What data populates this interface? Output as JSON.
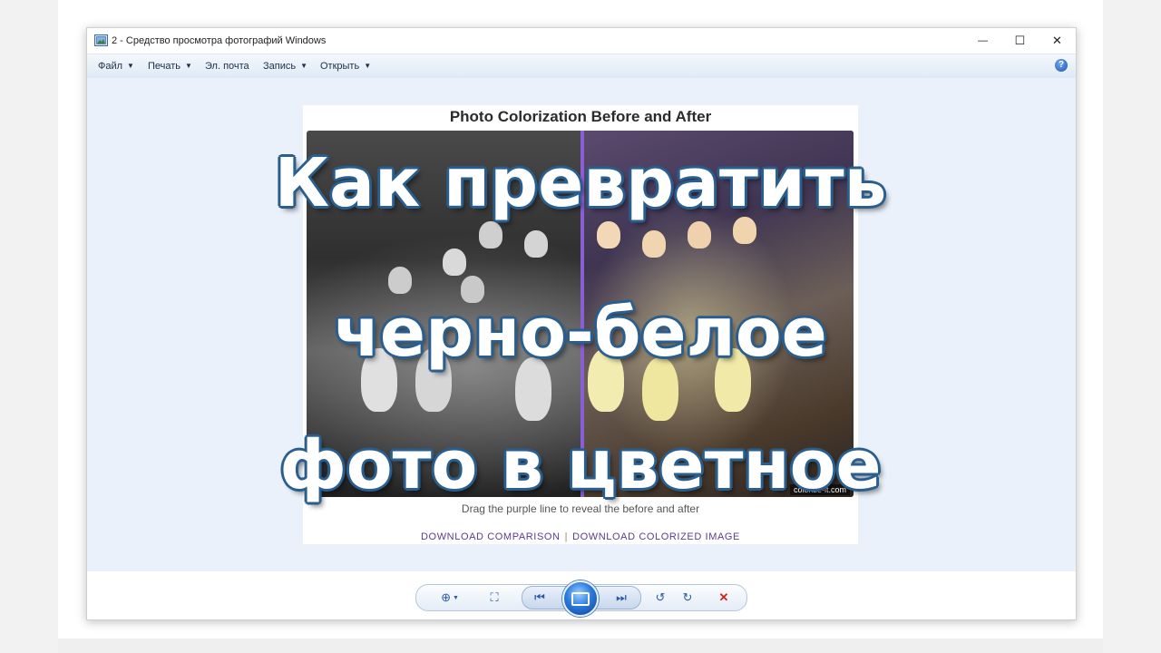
{
  "window": {
    "title": "2 - Средство просмотра фотографий Windows",
    "minimize_glyph": "—",
    "maximize_glyph": "☐",
    "close_glyph": "✕"
  },
  "menu": {
    "items": [
      {
        "label": "Файл",
        "has_dropdown": true
      },
      {
        "label": "Печать",
        "has_dropdown": true
      },
      {
        "label": "Эл. почта",
        "has_dropdown": false
      },
      {
        "label": "Запись",
        "has_dropdown": true
      },
      {
        "label": "Открыть",
        "has_dropdown": true
      }
    ],
    "caret_glyph": "▼",
    "help_glyph": "?"
  },
  "image": {
    "title": "Photo Colorization Before and After",
    "caption": "Drag the purple line to reveal the before and after",
    "watermark": "colorize-it.com",
    "link_comparison": "DOWNLOAD COMPARISON",
    "link_separator": "|",
    "link_colorized": "DOWNLOAD COLORIZED IMAGE",
    "divider_color": "#8a5fd6",
    "divider_position": 0.5
  },
  "overlay": {
    "line1": "Как превратить",
    "line2": "черно-белое",
    "line3": "фото в цветное",
    "outline_color": "#2a5f8f"
  },
  "toolbar": {
    "zoom_glyph": "⊕",
    "fit_glyph": "⛶",
    "prev_glyph": "⏮",
    "next_glyph": "⏭",
    "rotate_ccw_glyph": "↺",
    "rotate_cw_glyph": "↻",
    "delete_glyph": "✕"
  },
  "colors": {
    "viewport_bg": "#eaf1fa",
    "menu_text": "#1e2f48",
    "link_color": "#5b3b93",
    "delete_red": "#d42020"
  }
}
